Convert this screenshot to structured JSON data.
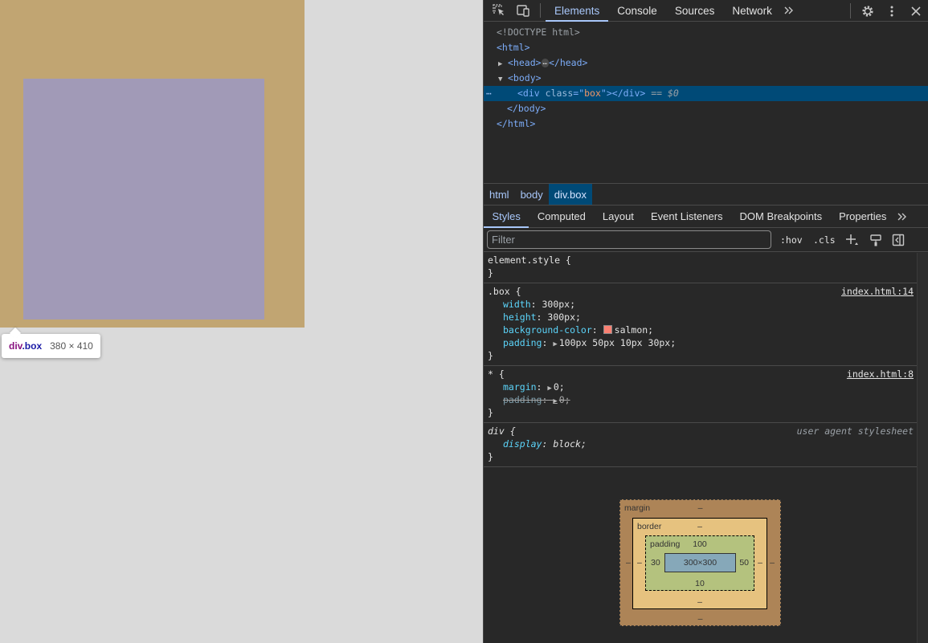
{
  "tooltip": {
    "tag": "div",
    "cls": ".box",
    "size": "380 × 410"
  },
  "devtools": {
    "tabs": [
      "Elements",
      "Console",
      "Sources",
      "Network"
    ],
    "active_tab": "Elements",
    "dom": {
      "doctype": "<!DOCTYPE html>",
      "html_open": "<html>",
      "head_open": "<head>",
      "head_close": "</head>",
      "body_open": "<body>",
      "div_tag_open": "<div",
      "div_attr": "class",
      "div_attr_eq": "=\"",
      "div_val": "box",
      "div_attr_close": "\">",
      "div_close": "</div>",
      "selected_marker": " == $0",
      "body_close": "</body>",
      "html_close": "</html>",
      "ellipsis": "…"
    },
    "breadcrumbs": [
      "html",
      "body",
      "div.box"
    ],
    "subtabs": [
      "Styles",
      "Computed",
      "Layout",
      "Event Listeners",
      "DOM Breakpoints",
      "Properties"
    ],
    "filter": {
      "placeholder": "Filter",
      "hov": ":hov",
      "cls": ".cls"
    },
    "rules": {
      "element_style": {
        "selector": "element.style {",
        "close": "}"
      },
      "box": {
        "selector": ".box {",
        "source": "index.html:14",
        "props": [
          {
            "name": "width",
            "value": "300px;"
          },
          {
            "name": "height",
            "value": "300px;"
          },
          {
            "name": "background-color",
            "value": "salmon;"
          },
          {
            "name": "padding",
            "value": "100px 50px 10px 30px;"
          }
        ],
        "close": "}"
      },
      "star": {
        "selector": "* {",
        "source": "index.html:8",
        "props": [
          {
            "name": "margin",
            "value": "0;"
          },
          {
            "name": "padding",
            "value": "0;"
          }
        ],
        "close": "}"
      },
      "div": {
        "selector": "div {",
        "source": "user agent stylesheet",
        "props": [
          {
            "name": "display",
            "value": "block;"
          }
        ],
        "close": "}"
      }
    },
    "box_model": {
      "margin_label": "margin",
      "margin_top": "–",
      "margin_bottom": "–",
      "margin_left": "–",
      "margin_right": "–",
      "border_label": "border",
      "border_top": "–",
      "border_bottom": "–",
      "border_left": "–",
      "border_right": "–",
      "padding_label": "padding",
      "padding_top": "100",
      "padding_bottom": "10",
      "padding_left": "30",
      "padding_right": "50",
      "content": "300×300"
    },
    "colors": {
      "swatch": "#fa8072",
      "accent": "#a8c7fa",
      "selection": "#004a77"
    },
    "icons": [
      "inspect-element-icon",
      "device-toolbar-icon",
      "more-tabs-icon",
      "settings-gear-icon",
      "kebab-menu-icon",
      "close-icon",
      "new-style-rule-icon",
      "paint-format-icon",
      "toggle-sidebar-icon"
    ]
  }
}
